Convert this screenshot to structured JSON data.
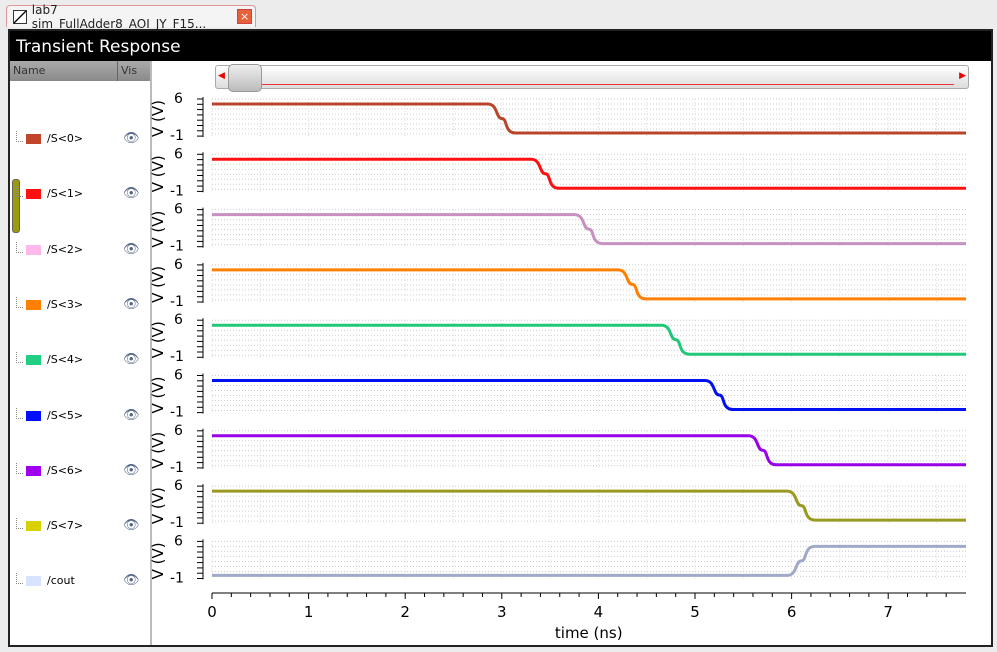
{
  "tab": {
    "title": "lab7 sim_FullAdder8_AOI_JY_F15...",
    "close_icon": "close-icon"
  },
  "window": {
    "title": "Transient Response"
  },
  "list": {
    "name_header": "Name",
    "vis_header": "Vis"
  },
  "signals": [
    {
      "name": "/S<0>",
      "legend": "#c0452a",
      "line": "#b8452a",
      "t": 3.0,
      "dir": "fall"
    },
    {
      "name": "/S<1>",
      "legend": "#ff1010",
      "line": "#ff1010",
      "t": 3.45,
      "dir": "fall"
    },
    {
      "name": "/S<2>",
      "legend": "#ffb8e8",
      "line": "#c890c0",
      "t": 3.9,
      "dir": "fall"
    },
    {
      "name": "/S<3>",
      "legend": "#ff8000",
      "line": "#ff8000",
      "t": 4.35,
      "dir": "fall"
    },
    {
      "name": "/S<4>",
      "legend": "#20d080",
      "line": "#20c878",
      "t": 4.8,
      "dir": "fall"
    },
    {
      "name": "/S<5>",
      "legend": "#0010ff",
      "line": "#0010f0",
      "t": 5.25,
      "dir": "fall"
    },
    {
      "name": "/S<6>",
      "legend": "#a000f0",
      "line": "#9a00e8",
      "t": 5.7,
      "dir": "fall"
    },
    {
      "name": "/S<7>",
      "legend": "#d8d000",
      "line": "#9a9a20",
      "t": 6.1,
      "dir": "fall"
    },
    {
      "name": "/cout",
      "legend": "#d8e4ff",
      "line": "#a0aac8",
      "t": 6.1,
      "dir": "rise"
    }
  ],
  "chart_data": {
    "type": "line",
    "xlabel": "time (ns)",
    "ylabel": "V (V)",
    "xlim": [
      0,
      7.8
    ],
    "ylim": [
      -1,
      6
    ],
    "xticks": [
      "0",
      "1",
      "2",
      "3",
      "4",
      "5",
      "6",
      "7"
    ],
    "yticks": [
      "6",
      "-1"
    ],
    "high_v": 5,
    "low_v": 0
  }
}
